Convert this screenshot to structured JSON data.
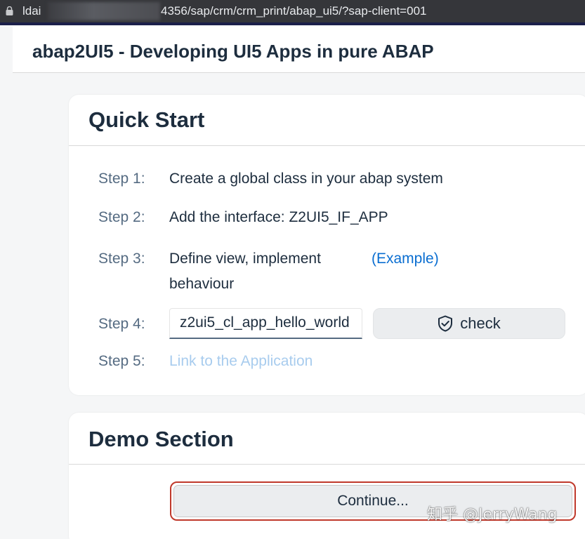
{
  "browser": {
    "host": "ldai",
    "path": "4356/sap/crm/crm_print/abap_ui5/?sap-client=001"
  },
  "shell": {
    "title": "abap2UI5 - Developing UI5 Apps in pure ABAP"
  },
  "quick_start": {
    "title": "Quick Start",
    "steps": [
      {
        "label": "Step 1:",
        "text": "Create a global class in your abap system"
      },
      {
        "label": "Step 2:",
        "text": "Add the interface: Z2UI5_IF_APP"
      },
      {
        "label": "Step 3:",
        "text_line1": "Define view, implement",
        "text_line2": "behaviour",
        "link": "(Example)"
      },
      {
        "label": "Step 4:",
        "input_value": "z2ui5_cl_app_hello_world",
        "button_label": "check",
        "button_icon": "shield-check-icon"
      },
      {
        "label": "Step 5:",
        "link": "Link to the Application"
      }
    ]
  },
  "demo": {
    "title": "Demo Section",
    "continue_label": "Continue..."
  },
  "watermark": {
    "text": "知乎 @JerryWang"
  },
  "colors": {
    "accent": "#0a6ed1",
    "disabled_link": "#a8ccee",
    "highlight_border": "#c0392b",
    "tab_strip": "#1b1f4a"
  }
}
